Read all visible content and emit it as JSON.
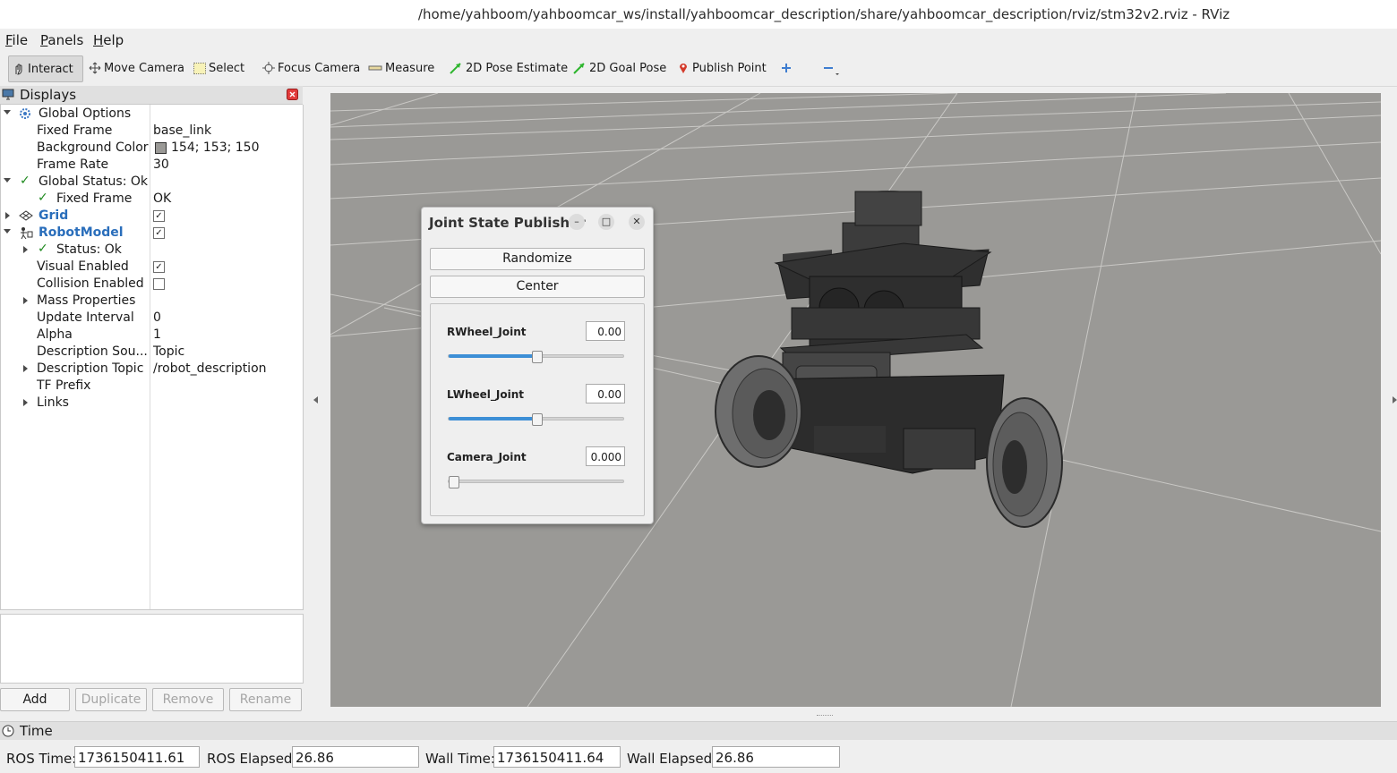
{
  "window": {
    "title": "/home/yahboom/yahboomcar_ws/install/yahboomcar_description/share/yahboomcar_description/rviz/stm32v2.rviz - RViz"
  },
  "menu": [
    "File",
    "Panels",
    "Help"
  ],
  "toolbar": {
    "interact": "Interact",
    "move_camera": "Move Camera",
    "select": "Select",
    "focus_camera": "Focus Camera",
    "measure": "Measure",
    "pose_estimate": "2D Pose Estimate",
    "goal_pose": "2D Goal Pose",
    "publish_point": "Publish Point"
  },
  "displays": {
    "title": "Displays",
    "rows": [
      {
        "name": "Global Options"
      },
      {
        "name": "Fixed Frame",
        "value": "base_link"
      },
      {
        "name": "Background Color",
        "value": "154; 153; 150",
        "color": "#9a9996"
      },
      {
        "name": "Frame Rate",
        "value": "30"
      },
      {
        "name": "Global Status: Ok"
      },
      {
        "name": "Fixed Frame",
        "value": "OK"
      },
      {
        "name": "Grid",
        "checked": true
      },
      {
        "name": "RobotModel",
        "checked": true
      },
      {
        "name": "Status: Ok"
      },
      {
        "name": "Visual Enabled",
        "checked": true
      },
      {
        "name": "Collision Enabled",
        "checked": false
      },
      {
        "name": "Mass Properties"
      },
      {
        "name": "Update Interval",
        "value": "0"
      },
      {
        "name": "Alpha",
        "value": "1"
      },
      {
        "name": "Description Sou...",
        "value": "Topic"
      },
      {
        "name": "Description Topic",
        "value": "/robot_description"
      },
      {
        "name": "TF Prefix"
      },
      {
        "name": "Links"
      }
    ],
    "buttons": {
      "add": "Add",
      "duplicate": "Duplicate",
      "remove": "Remove",
      "rename": "Rename"
    }
  },
  "jsp": {
    "title": "Joint State Publisher",
    "randomize": "Randomize",
    "center": "Center",
    "joints": [
      {
        "name": "RWheel_Joint",
        "value": "0.00",
        "fraction": 0.5
      },
      {
        "name": "LWheel_Joint",
        "value": "0.00",
        "fraction": 0.5
      },
      {
        "name": "Camera_Joint",
        "value": "0.000",
        "fraction": 0.0
      }
    ]
  },
  "time": {
    "title": "Time",
    "ros_time_label": "ROS Time:",
    "ros_time": "1736150411.61",
    "ros_elapsed_label": "ROS Elapsed:",
    "ros_elapsed": "26.86",
    "wall_time_label": "Wall Time:",
    "wall_time": "1736150411.64",
    "wall_elapsed_label": "Wall Elapsed:",
    "wall_elapsed": "26.86"
  },
  "colors": {
    "viewport_bg": "#9a9996",
    "accent": "#3d8fd6",
    "link_blue": "#2a6ebb"
  }
}
